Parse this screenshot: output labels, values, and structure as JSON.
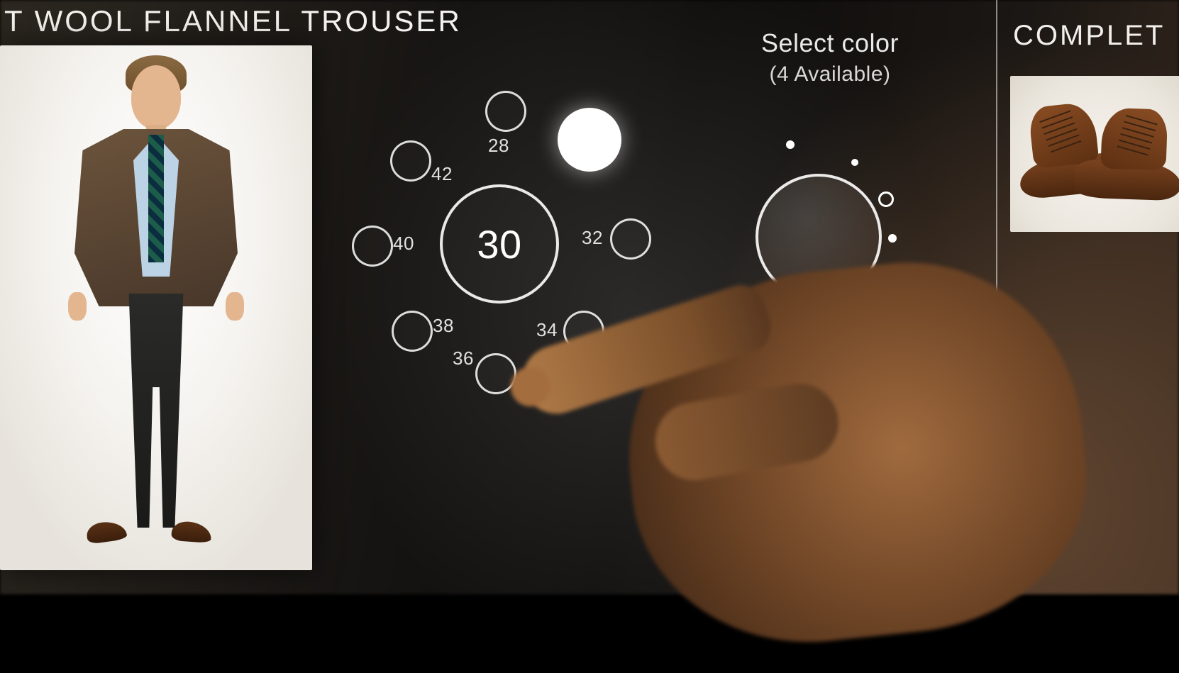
{
  "product": {
    "title": "T WOOL FLANNEL TROUSER"
  },
  "sizes": {
    "selected": "30",
    "options": [
      "28",
      "30",
      "32",
      "34",
      "36",
      "38",
      "40",
      "42"
    ]
  },
  "color": {
    "title": "Select color",
    "subtitle": "(4 Available)",
    "available_count": 4
  },
  "complete": {
    "title": "COMPLET"
  }
}
